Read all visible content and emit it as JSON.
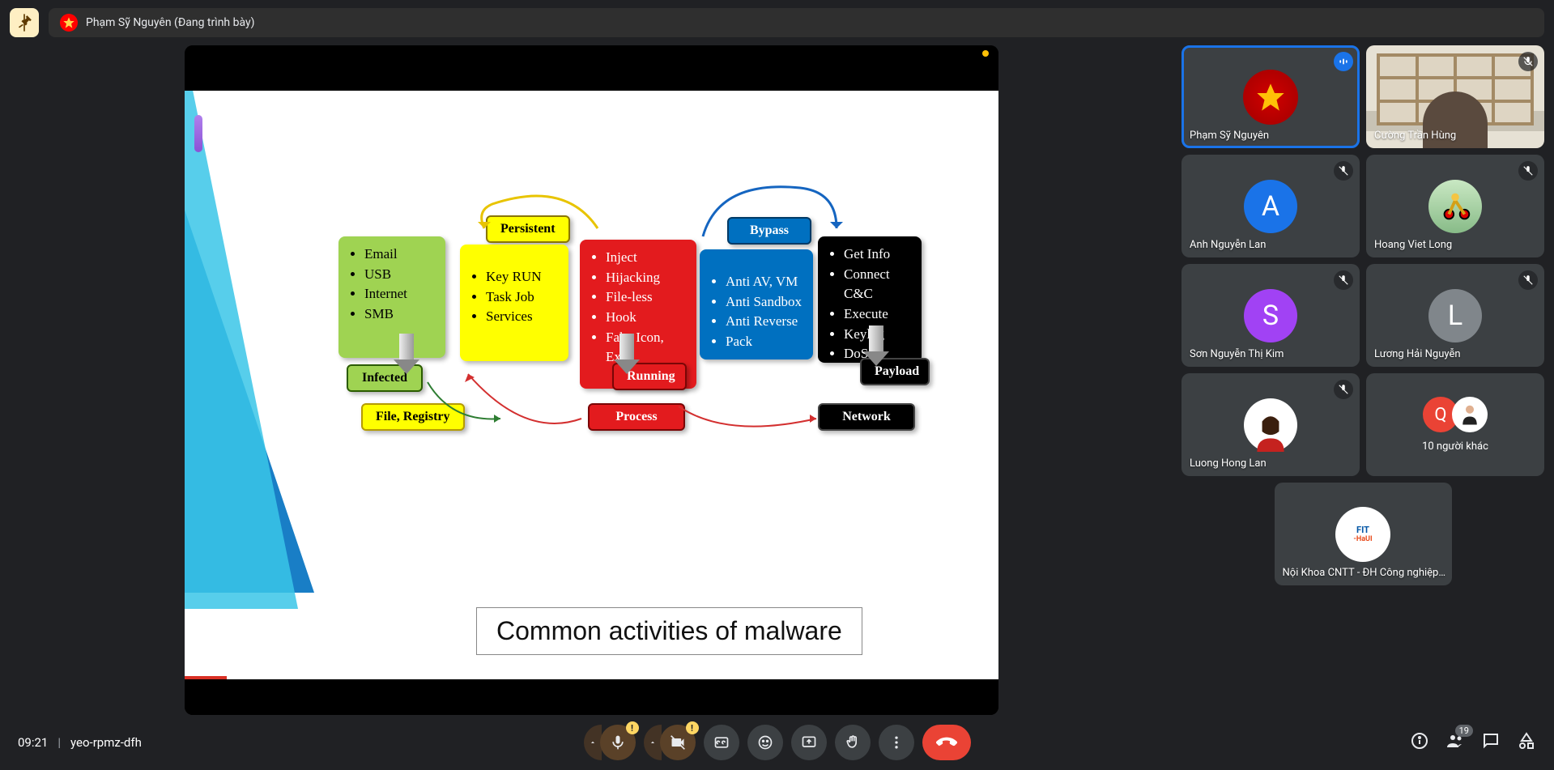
{
  "presenter": {
    "name_full": "Phạm Sỹ Nguyên (Đang trình bày)"
  },
  "slide": {
    "title": "Common activities of malware",
    "labels": {
      "infected": "Infected",
      "persistent": "Persistent",
      "file_registry": "File, Registry",
      "running": "Running",
      "process": "Process",
      "bypass": "Bypass",
      "payload": "Payload",
      "network": "Network"
    },
    "col1": [
      "Email",
      "USB",
      "Internet",
      "SMB"
    ],
    "col2": [
      "Key RUN",
      "Task Job",
      "Services"
    ],
    "col3": [
      "Inject",
      "Hijacking",
      "File-less",
      "Hook",
      "Fake Icon, Ext"
    ],
    "col4": [
      "Anti AV, VM",
      "Anti Sandbox",
      "Anti Reverse",
      "Pack"
    ],
    "col5": [
      "Get Info",
      "Connect C&C",
      "Execute",
      "Keylog",
      "DoS",
      "…"
    ]
  },
  "participants": [
    {
      "name": "Phạm Sỹ Nguyên",
      "type": "star",
      "speaking": true,
      "muted": false
    },
    {
      "name": "Cường Trần Hùng",
      "type": "room",
      "speaking": false,
      "muted": true
    },
    {
      "name": "Anh Nguyễn Lan",
      "type": "letter",
      "letter": "A",
      "color": "#1a73e8",
      "muted": true
    },
    {
      "name": "Hoang Viet Long",
      "type": "photo",
      "color": "#f4b400",
      "muted": true
    },
    {
      "name": "Sơn Nguyễn Thị Kim",
      "type": "letter",
      "letter": "S",
      "color": "#a142f4",
      "muted": true
    },
    {
      "name": "Lương Hải Nguyễn",
      "type": "letter",
      "letter": "L",
      "color": "#80868b",
      "muted": true
    },
    {
      "name": "Luong Hong Lan",
      "type": "photo",
      "color": "#c5221f",
      "muted": true
    },
    {
      "name": "10 người khác",
      "type": "overflow",
      "letter": "Q",
      "color": "#ea4335",
      "muted": false
    },
    {
      "name": "Nội Khoa CNTT - ĐH Công nghiệp…",
      "type": "fit",
      "muted": false
    }
  ],
  "bottombar": {
    "time": "09:21",
    "code": "yeo-rpmz-dfh",
    "participant_count": "19",
    "mic_warning": "!",
    "cam_warning": "!"
  }
}
